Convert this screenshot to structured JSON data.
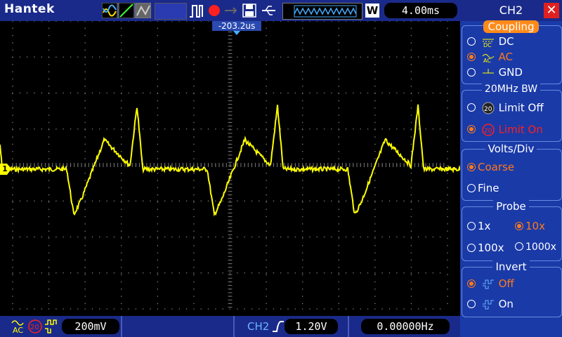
{
  "header": {
    "brand": "Hantek",
    "time_base": "4.00ms",
    "trigger_mode_label": "W",
    "offset_marker": "-203.2us"
  },
  "footer": {
    "coupling_icon": "ac-coupling-icon",
    "bandwidth_icon": "bw-limit-20-icon",
    "ch_volts_div": "200mV",
    "trigger_channel": "CH2",
    "trigger_level": "1.20V",
    "frequency": "0.00000Hz"
  },
  "side_panel": {
    "title": "CH2",
    "coupling": {
      "heading": "Coupling",
      "options": [
        {
          "label": "DC",
          "selected": false
        },
        {
          "label": "AC",
          "selected": true
        },
        {
          "label": "GND",
          "selected": false
        }
      ]
    },
    "bandwidth": {
      "heading": "20MHz BW",
      "options": [
        {
          "label": "Limit Off",
          "selected": false
        },
        {
          "label": "Limit On",
          "selected": true
        }
      ]
    },
    "volts_div": {
      "heading": "Volts/Div",
      "options": [
        {
          "label": "Coarse",
          "selected": true
        },
        {
          "label": "Fine",
          "selected": false
        }
      ]
    },
    "probe": {
      "heading": "Probe",
      "options": [
        {
          "label": "1x",
          "selected": false
        },
        {
          "label": "10x",
          "selected": true
        },
        {
          "label": "100x",
          "selected": false
        },
        {
          "label": "1000x",
          "selected": false
        }
      ]
    },
    "invert": {
      "heading": "Invert",
      "options": [
        {
          "label": "Off",
          "selected": true
        },
        {
          "label": "On",
          "selected": false
        }
      ]
    }
  },
  "channel_marker": "1",
  "colors": {
    "trace": "#ffff00",
    "selected": "#ff7a1a",
    "bar": "#1a2a8a",
    "panel": "#1a3aa8"
  }
}
